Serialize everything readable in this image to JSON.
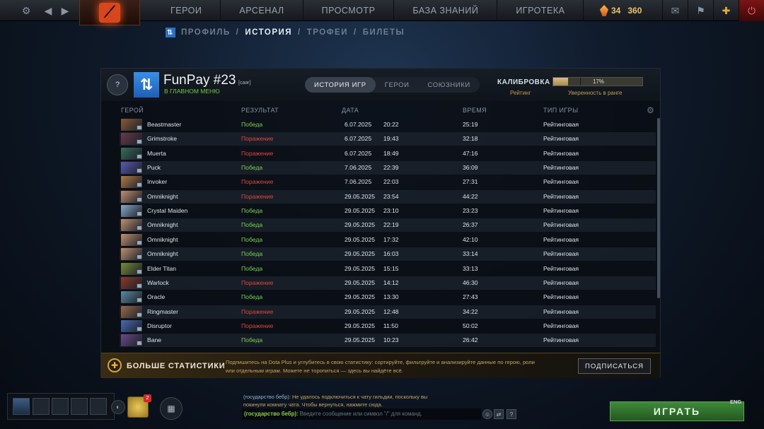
{
  "top_nav": {
    "items": [
      "ГЕРОИ",
      "АРСЕНАЛ",
      "ПРОСМОТР",
      "БАЗА ЗНАНИЙ",
      "ИГРОТЕКА"
    ],
    "currency": {
      "shards_count": "34",
      "gold_count": "360"
    }
  },
  "sub_nav": {
    "items": [
      "ПРОФИЛЬ",
      "ИСТОРИЯ",
      "ТРОФЕИ",
      "БИЛЕТЫ"
    ],
    "separator": "/",
    "active": "ИСТОРИЯ"
  },
  "profile": {
    "rank_badge": "?",
    "name": "FunPay #23",
    "tag": "[саяг]",
    "status": "В ГЛАВНОМ МЕНЮ"
  },
  "tabs": [
    "ИСТОРИЯ ИГР",
    "ГЕРОИ",
    "СОЮЗНИКИ"
  ],
  "calibration": {
    "label": "КАЛИБРОВКА",
    "progress_percent": 17,
    "progress_text": "17%",
    "rating_label": "Рейтинг",
    "confidence_label": "Уверенность в ранге"
  },
  "columns": {
    "hero": "ГЕРОЙ",
    "result": "РЕЗУЛЬТАТ",
    "date": "ДАТА",
    "duration": "ВРЕМЯ",
    "type": "ТИП ИГРЫ"
  },
  "matches": [
    {
      "hero": "Beastmaster",
      "result": "Победа",
      "win": true,
      "date": "6.07.2025",
      "time": "20:22",
      "duration": "25:19",
      "type": "Рейтинговая",
      "color": "#8a5a3a"
    },
    {
      "hero": "Grimstroke",
      "result": "Поражение",
      "win": false,
      "date": "6.07.2025",
      "time": "19:43",
      "duration": "32:18",
      "type": "Рейтинговая",
      "color": "#6a3a4a"
    },
    {
      "hero": "Muerta",
      "result": "Поражение",
      "win": false,
      "date": "6.07.2025",
      "time": "18:49",
      "duration": "47:16",
      "type": "Рейтинговая",
      "color": "#3a6a5a"
    },
    {
      "hero": "Puck",
      "result": "Победа",
      "win": true,
      "date": "7.06.2025",
      "time": "22:39",
      "duration": "36:09",
      "type": "Рейтинговая",
      "color": "#5a5ab0"
    },
    {
      "hero": "Invoker",
      "result": "Поражение",
      "win": false,
      "date": "7.06.2025",
      "time": "22:03",
      "duration": "27:31",
      "type": "Рейтинговая",
      "color": "#b07a4a"
    },
    {
      "hero": "Omniknight",
      "result": "Поражение",
      "win": false,
      "date": "29.05.2025",
      "time": "23:54",
      "duration": "44:22",
      "type": "Рейтинговая",
      "color": "#c09070"
    },
    {
      "hero": "Crystal Maiden",
      "result": "Победа",
      "win": true,
      "date": "29.05.2025",
      "time": "23:10",
      "duration": "23:23",
      "type": "Рейтинговая",
      "color": "#8aa8c8"
    },
    {
      "hero": "Omniknight",
      "result": "Победа",
      "win": true,
      "date": "29.05.2025",
      "time": "22:19",
      "duration": "26:37",
      "type": "Рейтинговая",
      "color": "#c09070"
    },
    {
      "hero": "Omniknight",
      "result": "Победа",
      "win": true,
      "date": "29.05.2025",
      "time": "17:32",
      "duration": "42:10",
      "type": "Рейтинговая",
      "color": "#c09070"
    },
    {
      "hero": "Omniknight",
      "result": "Победа",
      "win": true,
      "date": "29.05.2025",
      "time": "16:03",
      "duration": "33:14",
      "type": "Рейтинговая",
      "color": "#c09070"
    },
    {
      "hero": "Elder Titan",
      "result": "Победа",
      "win": true,
      "date": "29.05.2025",
      "time": "15:15",
      "duration": "33:13",
      "type": "Рейтинговая",
      "color": "#7a8a3a"
    },
    {
      "hero": "Warlock",
      "result": "Поражение",
      "win": false,
      "date": "29.05.2025",
      "time": "14:12",
      "duration": "46:30",
      "type": "Рейтинговая",
      "color": "#8a3a2a"
    },
    {
      "hero": "Oracle",
      "result": "Победа",
      "win": true,
      "date": "29.05.2025",
      "time": "13:30",
      "duration": "27:43",
      "type": "Рейтинговая",
      "color": "#5a8aa0"
    },
    {
      "hero": "Ringmaster",
      "result": "Поражение",
      "win": false,
      "date": "29.05.2025",
      "time": "12:48",
      "duration": "34:22",
      "type": "Рейтинговая",
      "color": "#9a6a4a"
    },
    {
      "hero": "Disruptor",
      "result": "Поражение",
      "win": false,
      "date": "29.05.2025",
      "time": "11:50",
      "duration": "50:02",
      "type": "Рейтинговая",
      "color": "#4a6ab0"
    },
    {
      "hero": "Bane",
      "result": "Победа",
      "win": true,
      "date": "29.05.2025",
      "time": "10:23",
      "duration": "26:42",
      "type": "Рейтинговая",
      "color": "#6a4a8a"
    }
  ],
  "dota_plus": {
    "title": "БОЛЬШЕ СТАТИСТИКИ",
    "description": "Подпишитесь на Dota Plus и углубитесь в свою статистику: сортируйте, фильтруйте и анализируйте данные по герою, роли или отдельным играм. Можете не торопиться — здесь вы найдёте всё.",
    "button": "ПОДПИСАТЬСЯ"
  },
  "party": {
    "notification_count": "2"
  },
  "chat": {
    "message_author": "(государство бебр):",
    "message_text": "Не удалось подключиться к чату гильдии, поскольку вы покинули комнату чата. Чтобы вернуться, нажмите сюда.",
    "channel": "(государство бебр):",
    "placeholder": "Введите сообщение или символ \"/\" для команд."
  },
  "play_button": "ИГРАТЬ",
  "language": "ENG"
}
